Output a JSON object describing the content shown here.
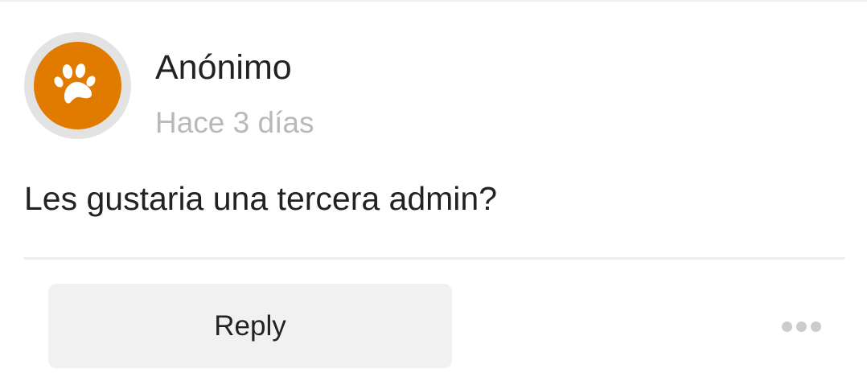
{
  "comment": {
    "author": "Anónimo",
    "timestamp": "Hace 3 días",
    "message": "Les gustaria una tercera admin?",
    "avatar_icon": "paw-icon",
    "avatar_color": "#e07b00"
  },
  "actions": {
    "reply_label": "Reply",
    "more_icon": "more-horizontal-icon"
  }
}
